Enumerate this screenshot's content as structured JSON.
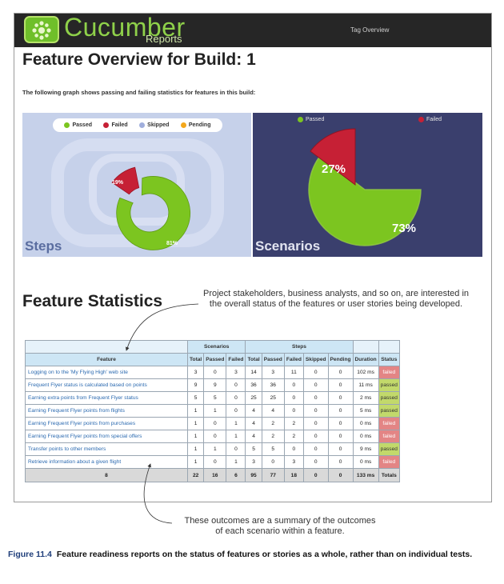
{
  "header": {
    "brand": "Cucumber",
    "brand_sub": "Reports",
    "nav_link": "Tag Overview"
  },
  "page_title": "Feature Overview for Build: 1",
  "graph_description": "The following graph shows passing and failing statistics for features in this build:",
  "steps_chart": {
    "label": "Steps",
    "legend": [
      "Passed",
      "Failed",
      "Skipped",
      "Pending"
    ],
    "passed_pct": "81%",
    "failed_pct": "19%"
  },
  "scenarios_chart": {
    "label": "Scenarios",
    "legend": [
      "Passed",
      "Failed"
    ],
    "passed_pct": "73%",
    "failed_pct": "27%"
  },
  "colors": {
    "passed": "#7cc520",
    "failed": "#c62035",
    "skipped": "#a0aedc",
    "pending": "#f3a71c"
  },
  "stats_title": "Feature Statistics",
  "callout_top": [
    "Project stakeholders, business analysts, and so on, are interested in",
    "the overall status of the features or user stories being developed."
  ],
  "callout_bottom": [
    "These outcomes are a summary of the outcomes",
    "of each scenario within a feature."
  ],
  "table": {
    "group_headers": [
      "Scenarios",
      "Steps"
    ],
    "columns": [
      "Feature",
      "Total",
      "Passed",
      "Failed",
      "Total",
      "Passed",
      "Failed",
      "Skipped",
      "Pending",
      "Duration",
      "Status"
    ],
    "rows": [
      [
        "Logging on to the 'My Flying High' web site",
        "3",
        "0",
        "3",
        "14",
        "3",
        "11",
        "0",
        "0",
        "102 ms",
        "failed"
      ],
      [
        "Frequent Flyer status is calculated based on points",
        "9",
        "9",
        "0",
        "36",
        "36",
        "0",
        "0",
        "0",
        "11 ms",
        "passed"
      ],
      [
        "Earning extra points from Frequent Flyer status",
        "5",
        "5",
        "0",
        "25",
        "25",
        "0",
        "0",
        "0",
        "2 ms",
        "passed"
      ],
      [
        "Earning Frequent Flyer points from flights",
        "1",
        "1",
        "0",
        "4",
        "4",
        "0",
        "0",
        "0",
        "5 ms",
        "passed"
      ],
      [
        "Earning Frequent Flyer points from purchases",
        "1",
        "0",
        "1",
        "4",
        "2",
        "2",
        "0",
        "0",
        "0 ms",
        "failed"
      ],
      [
        "Earning Frequent Flyer points from special offers",
        "1",
        "0",
        "1",
        "4",
        "2",
        "2",
        "0",
        "0",
        "0 ms",
        "failed"
      ],
      [
        "Transfer points to other members",
        "1",
        "1",
        "0",
        "5",
        "5",
        "0",
        "0",
        "0",
        "9 ms",
        "passed"
      ],
      [
        "Retrieve information about a given flight",
        "1",
        "0",
        "1",
        "3",
        "0",
        "3",
        "0",
        "0",
        "0 ms",
        "failed"
      ]
    ],
    "totals": [
      "8",
      "22",
      "16",
      "6",
      "95",
      "77",
      "18",
      "0",
      "0",
      "133 ms",
      "Totals"
    ]
  },
  "caption": {
    "label": "Figure 11.4",
    "text": "Feature readiness reports on the status of features or stories as a whole, rather than on individual tests."
  }
}
